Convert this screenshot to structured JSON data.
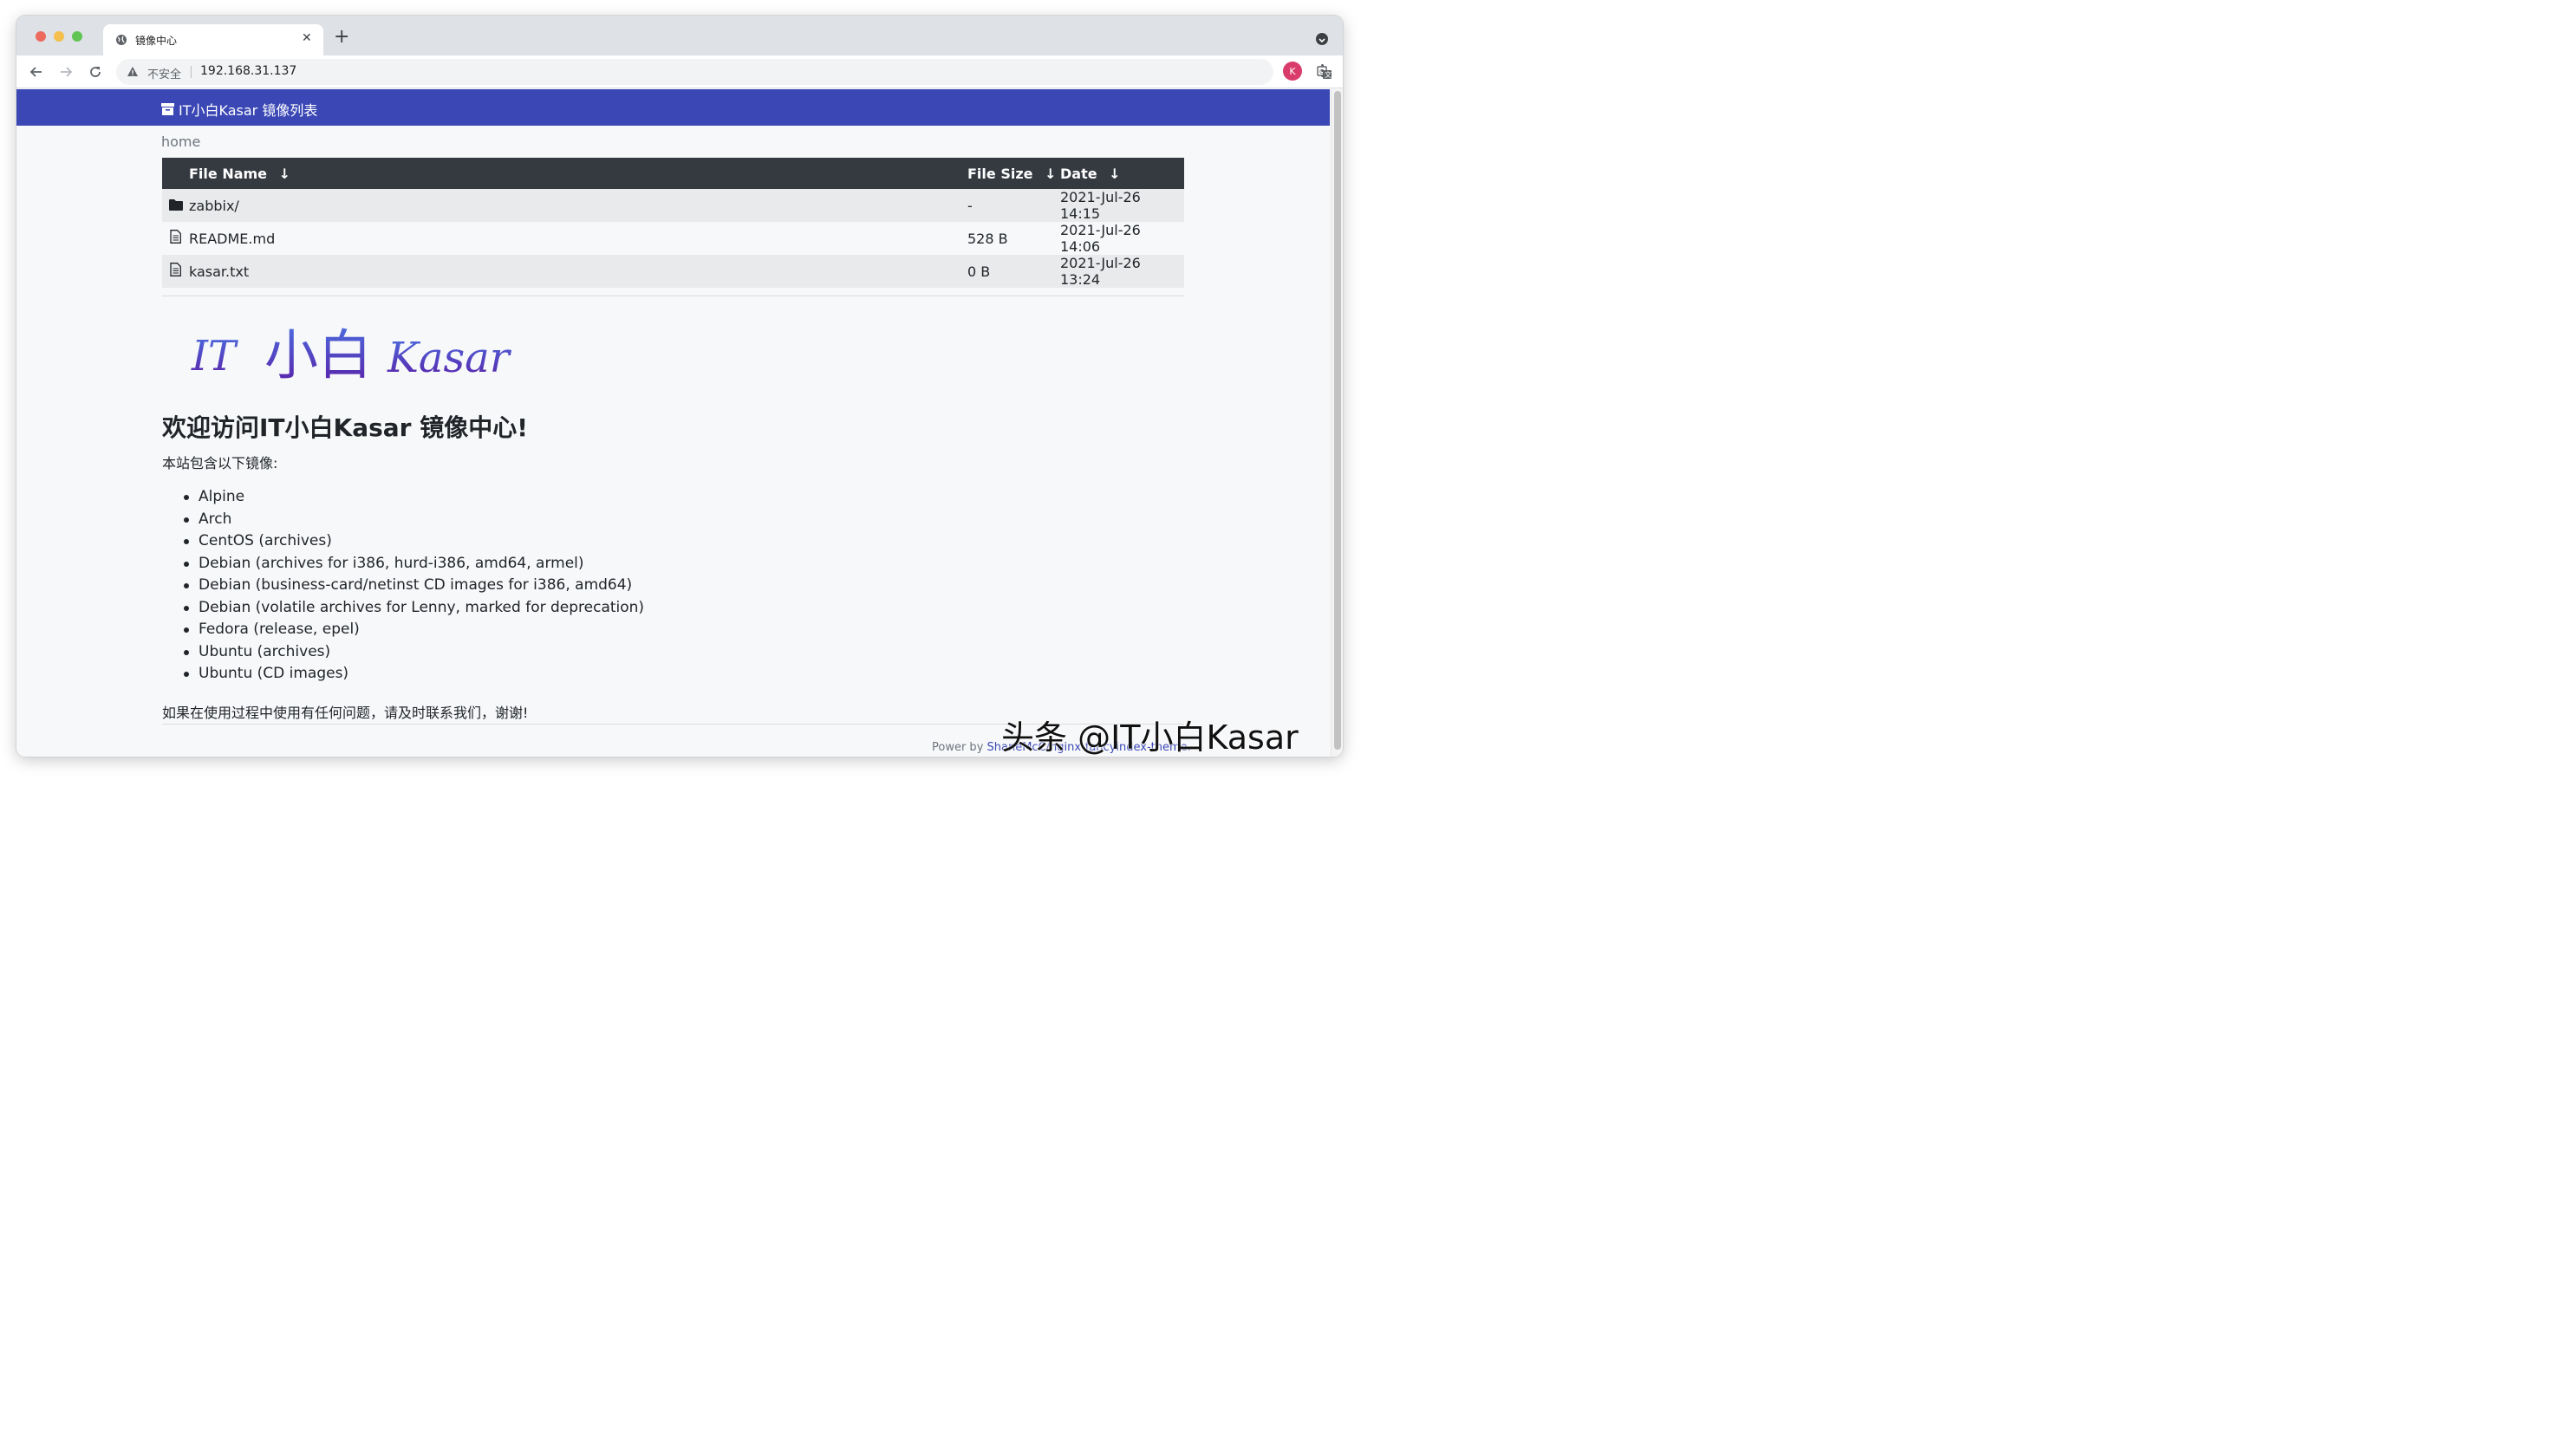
{
  "tab": {
    "title": "镜像中心"
  },
  "address": {
    "security_label": "不安全",
    "url": "192.168.31.137"
  },
  "avatar": {
    "initial": "K"
  },
  "header": {
    "brand": "IT小白Kasar 镜像列表"
  },
  "breadcrumb": "home",
  "table": {
    "headers": {
      "name": "File Name",
      "size": "File Size",
      "date": "Date",
      "sort_arrow": "↓"
    },
    "rows": [
      {
        "name": "zabbix/",
        "size": "-",
        "date": "2021-Jul-26 14:15",
        "icon": "folder-icon"
      },
      {
        "name": "README.md",
        "size": "528 B",
        "date": "2021-Jul-26 14:06",
        "icon": "file-icon"
      },
      {
        "name": "kasar.txt",
        "size": "0 B",
        "date": "2021-Jul-26 13:24",
        "icon": "file-icon"
      }
    ]
  },
  "logo": {
    "part1": "IT",
    "part2": "小白",
    "part3": "Kasar"
  },
  "readme": {
    "title": "欢迎访问IT小白Kasar 镜像中心!",
    "intro": "本站包含以下镜像:",
    "items": [
      "Alpine",
      "Arch",
      "CentOS (archives)",
      "Debian (archives for i386, hurd-i386, amd64, armel)",
      "Debian (business-card/netinst CD images for i386, amd64)",
      "Debian (volatile archives for Lenny, marked for deprecation)",
      "Fedora (release, epel)",
      "Ubuntu (archives)",
      "Ubuntu (CD images)"
    ],
    "closing": "如果在使用过程中使用有任何问题，请及时联系我们，谢谢!"
  },
  "footer": {
    "prefix": "Power by ",
    "link": "ShaneMcC/nginx-fancyindex-theme."
  },
  "watermark": "头条 @IT小白Kasar",
  "colors": {
    "header": "#3a47b5",
    "table_head": "#343a40",
    "avatar": "#d93b6b"
  }
}
